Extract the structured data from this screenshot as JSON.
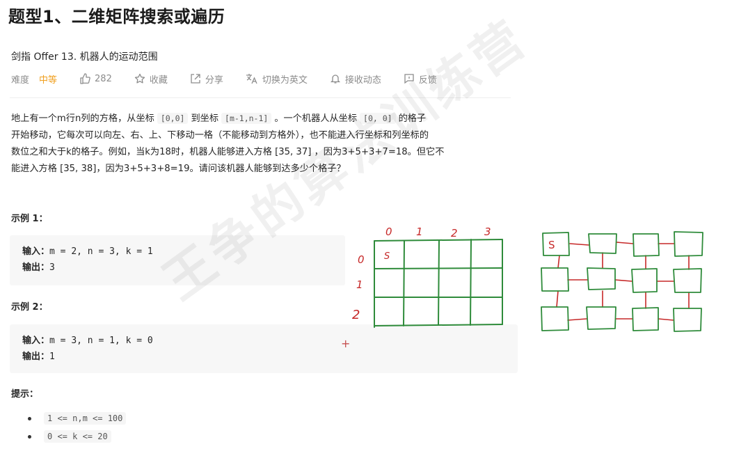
{
  "page_title": "题型1、二维矩阵搜索或遍历",
  "problem_title": "剑指 Offer 13. 机器人的运动范围",
  "meta": {
    "difficulty_label": "难度",
    "difficulty_value": "中等",
    "likes": "282",
    "favorite": "收藏",
    "share": "分享",
    "switch_lang": "切换为英文",
    "subscribe": "接收动态",
    "feedback": "反馈"
  },
  "description": {
    "l1_a": "地上有一个m行n列的方格，从坐标",
    "l1_code1": "[0,0]",
    "l1_b": "到坐标",
    "l1_code2": "[m-1,n-1]",
    "l1_c": "。一个机器人从坐标",
    "l1_code3": "[0, 0]",
    "l1_d": "的格子",
    "l2": "开始移动，它每次可以向左、右、上、下移动一格（不能移动到方格外），也不能进入行坐标和列坐标的",
    "l3": "数位之和大于k的格子。例如，当k为18时，机器人能够进入方格 [35, 37] ，因为3+5+3+7=18。但它不",
    "l4": "能进入方格 [35, 38]，因为3+5+3+8=19。请问该机器人能够到达多少个格子？"
  },
  "example1": {
    "heading": "示例 1：",
    "input_label": "输入：",
    "input_value": "m = 2, n = 3, k = 1",
    "output_label": "输出：",
    "output_value": "3"
  },
  "example2": {
    "heading": "示例 2：",
    "input_label": "输入：",
    "input_value": "m = 3, n = 1, k = 0",
    "output_label": "输出：",
    "output_value": "1"
  },
  "hints": {
    "heading": "提示：",
    "items": [
      "1 <= n,m <= 100",
      "0 <= k <= 20"
    ]
  },
  "watermark": "王争的算法训练营",
  "sketch": {
    "col_labels": [
      "0",
      "1",
      "2",
      "3"
    ],
    "row_labels": [
      "0",
      "1",
      "2"
    ],
    "start_cell": "S",
    "graph_start": "S",
    "colors": {
      "grid": "#2e8b3a",
      "labels": "#c62828",
      "edges": "#c62828"
    }
  }
}
